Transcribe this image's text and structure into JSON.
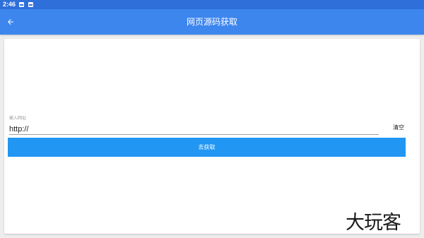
{
  "status_bar": {
    "time": "2:46",
    "icons": [
      "image-icon",
      "notification-icon"
    ]
  },
  "app_bar": {
    "back_icon": "arrow-left-icon",
    "title": "网页源码获取"
  },
  "form": {
    "url_label": "输入网址",
    "url_value": "http://",
    "clear_label": "清空",
    "fetch_label": "去获取"
  },
  "watermark": "大玩客",
  "colors": {
    "status_bar": "#2f6fd9",
    "app_bar": "#3d86ee",
    "fetch_button": "#2196f3",
    "background": "#ededed"
  }
}
